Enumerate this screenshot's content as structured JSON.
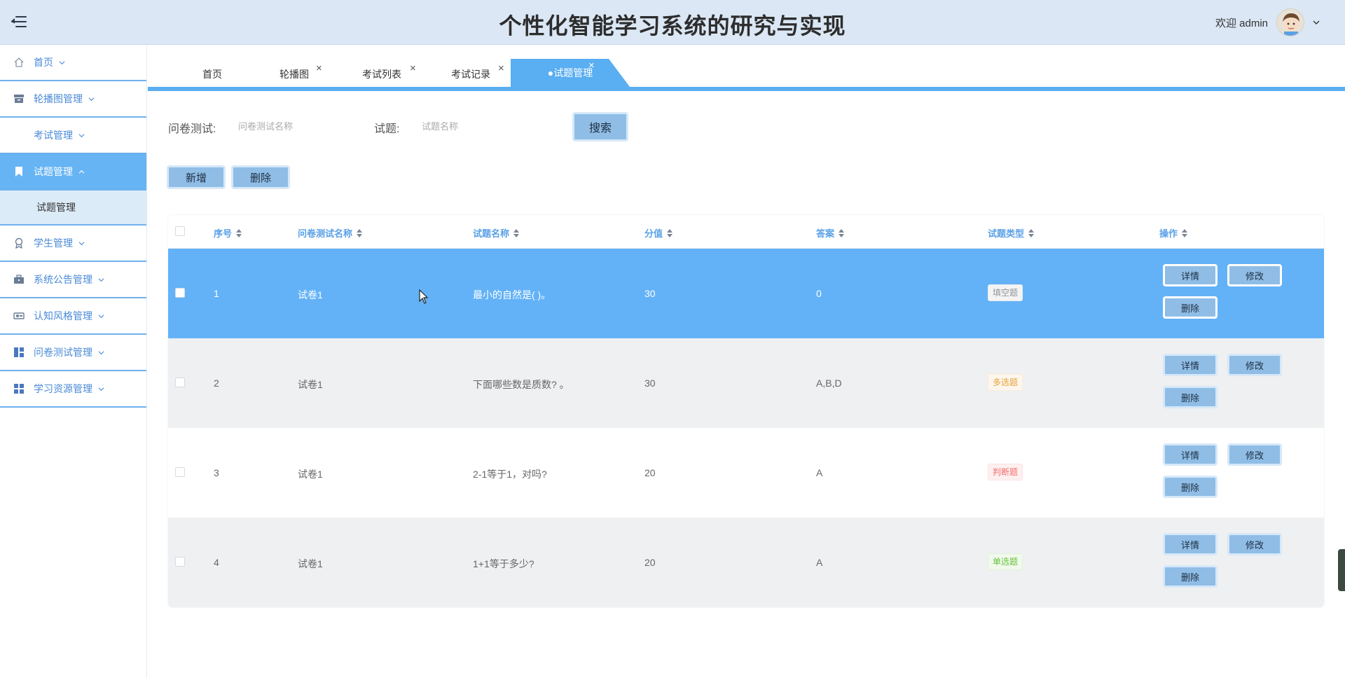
{
  "header": {
    "title": "个性化智能学习系统的研究与实现",
    "welcome": "欢迎 admin"
  },
  "sidebar": {
    "items": [
      {
        "label": "首页",
        "icon": "home-icon"
      },
      {
        "label": "轮播图管理",
        "icon": "archive-icon"
      },
      {
        "label": "考试管理",
        "icon": ""
      },
      {
        "label": "试题管理",
        "icon": "bookmark-icon",
        "active": true
      },
      {
        "label": "学生管理",
        "icon": "medal-icon"
      },
      {
        "label": "系统公告管理",
        "icon": "briefcase-icon"
      },
      {
        "label": "认知风格管理",
        "icon": "toggle-icon"
      },
      {
        "label": "问卷测试管理",
        "icon": "dashboard-icon"
      },
      {
        "label": "学习资源管理",
        "icon": "grid-icon"
      }
    ],
    "submenu": {
      "label": "试题管理"
    }
  },
  "tabs": [
    {
      "label": "首页",
      "closable": false
    },
    {
      "label": "轮播图",
      "closable": true
    },
    {
      "label": "考试列表",
      "closable": true
    },
    {
      "label": "考试记录",
      "closable": true
    },
    {
      "label": "●试题管理",
      "closable": true,
      "active": true
    }
  ],
  "tab_close_glyph": "×",
  "search": {
    "exam_label": "问卷测试:",
    "exam_placeholder": "问卷测试名称",
    "question_label": "试题:",
    "question_placeholder": "试题名称",
    "search_button": "搜索"
  },
  "actions": {
    "add": "新增",
    "delete": "删除"
  },
  "table": {
    "columns": [
      "序号",
      "问卷测试名称",
      "试题名称",
      "分值",
      "答案",
      "试题类型",
      "操作"
    ],
    "rows": [
      {
        "index": "1",
        "exam": "试卷1",
        "question": "最小的自然是( )。",
        "score": "30",
        "answer": "0",
        "type": "填空题",
        "tag_color": "gray",
        "selected": true
      },
      {
        "index": "2",
        "exam": "试卷1",
        "question": "下面哪些数是质数? 。",
        "score": "30",
        "answer": "A,B,D",
        "type": "多选题",
        "tag_color": "orange"
      },
      {
        "index": "3",
        "exam": "试卷1",
        "question": "2-1等于1，对吗?",
        "score": "20",
        "answer": "A",
        "type": "判断题",
        "tag_color": "red"
      },
      {
        "index": "4",
        "exam": "试卷1",
        "question": "1+1等于多少?",
        "score": "20",
        "answer": "A",
        "type": "单选题",
        "tag_color": "green"
      }
    ],
    "op_labels": {
      "detail": "详情",
      "edit": "修改",
      "delete": "删除"
    }
  },
  "colors": {
    "accent": "#5aaef2",
    "header_bg": "#dbe7f4",
    "button_bg": "#8fbde6",
    "selected_row": "#63b2f7"
  }
}
